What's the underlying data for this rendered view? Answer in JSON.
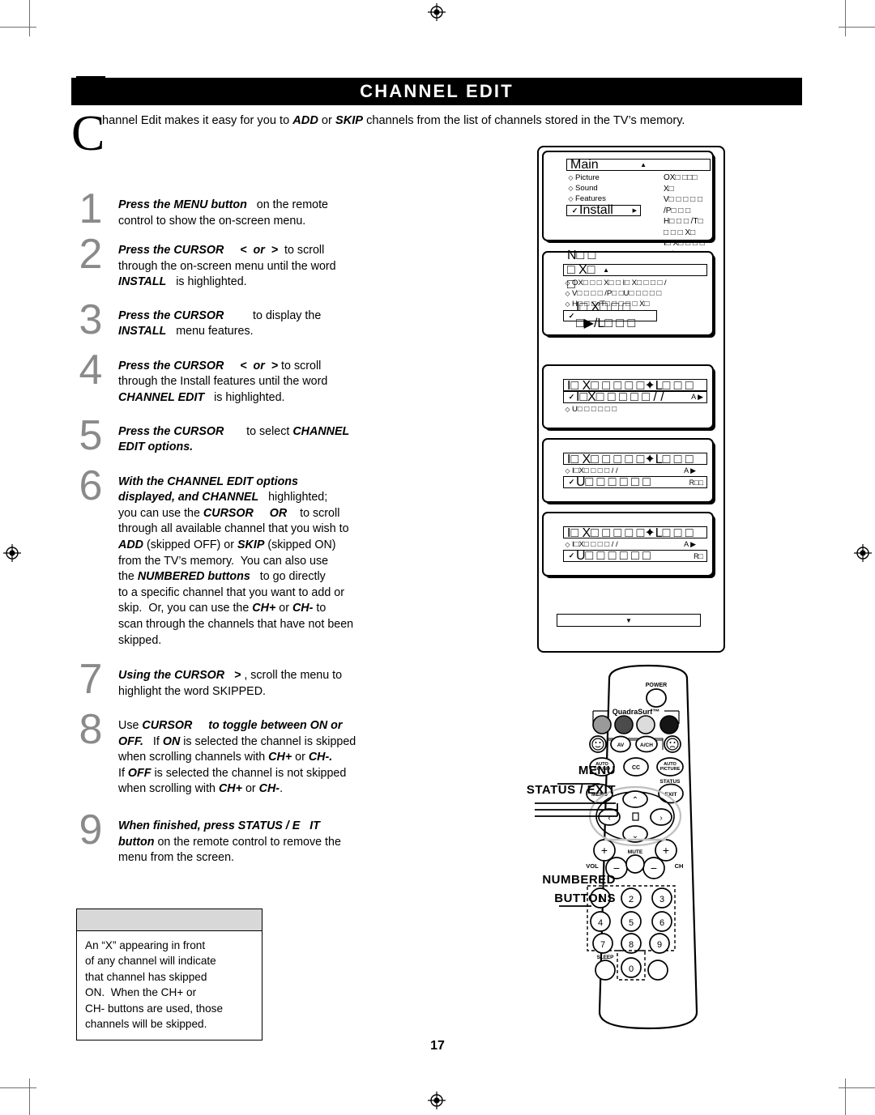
{
  "page": {
    "number": "17",
    "title": "CHANNEL EDIT"
  },
  "intro": {
    "dropcap": "C",
    "text_1": "hannel Edit makes it easy for you to ",
    "bold_1": "ADD",
    "text_2": " or ",
    "bold_2": "SKIP",
    "text_3": " channels from the list of channels stored in the TV’s memory."
  },
  "steps": [
    {
      "number": "1",
      "lines": [
        {
          "bold": "Press the MENU button",
          "rest": "  on the remote"
        },
        {
          "bold": "",
          "rest": "control to show the on-screen menu."
        }
      ]
    },
    {
      "number": "2",
      "lines": [
        {
          "bold": "Press the CURSOR",
          "rest": "   <   or  >   to scroll"
        },
        {
          "bold": "",
          "rest": "through the on-screen menu until the word"
        },
        {
          "bold": "INSTALL",
          "rest": "  is highlighted."
        }
      ]
    },
    {
      "number": "3",
      "lines": [
        {
          "bold": "Press the CURSOR",
          "rest": "          to display the"
        },
        {
          "bold": "INSTALL",
          "rest": "  menu features."
        }
      ]
    },
    {
      "number": "4",
      "lines": [
        {
          "bold": "Press the CURSOR",
          "rest": "   <   or  >  to scroll"
        },
        {
          "bold": "",
          "rest": "through the Install features until the word"
        },
        {
          "bold": "CHANNEL EDIT",
          "rest": "   is highlighted."
        }
      ]
    },
    {
      "number": "5",
      "lines": [
        {
          "bold": "Press the CURSOR",
          "rest": "        to select "
        },
        {
          "bold": "CHANNEL EDIT options.",
          "rest": ""
        }
      ]
    },
    {
      "number": "6",
      "lines": [
        {
          "bold": "With the CHANNEL EDIT options",
          "rest": ""
        },
        {
          "bold": "displayed, and CHANNEL",
          "rest": "    highlighted;"
        },
        {
          "bold": "",
          "rest": "you can use the "
        },
        {
          "bold": "CURSOR       OR",
          "rest": "    to scroll"
        },
        {
          "bold": "",
          "rest": "through all available channel that you wish to"
        },
        {
          "bold": "ADD",
          "rest": " (skipped OFF) or "
        },
        {
          "bold": "SKIP",
          "rest": " (skipped ON)"
        },
        {
          "bold": "",
          "rest": "from the TV’s memory.  You can also use"
        },
        {
          "bold": "the NUMBERED buttons",
          "rest": "   to go directly"
        },
        {
          "bold": "",
          "rest": "to a specific channel that you want to add or"
        },
        {
          "bold": "",
          "rest": "skip.  Or, you can use the "
        },
        {
          "bold": "CH+",
          "rest": " or "
        },
        {
          "bold": "CH-",
          "rest": " to"
        },
        {
          "bold": "",
          "rest": "scan through the channels that have not been"
        },
        {
          "bold": "",
          "rest": "skipped."
        }
      ]
    },
    {
      "number": "7",
      "lines": [
        {
          "bold": "Using the CURSOR",
          "rest": "   > , scroll the menu to"
        },
        {
          "bold": "",
          "rest": "highlight the word SKIPPED."
        }
      ]
    },
    {
      "number": "8",
      "lines": [
        {
          "bold": "",
          "rest": "Use "
        },
        {
          "bold": "CURSOR     to toggle between ON or",
          "rest": ""
        },
        {
          "bold": "OFF.",
          "rest": "   If "
        },
        {
          "bold": "ON",
          "rest": " is selected the channel is skipped"
        },
        {
          "bold": "",
          "rest": "when scrolling channels with "
        },
        {
          "bold": "CH+",
          "rest": " or "
        },
        {
          "bold": "CH-.",
          "rest": ""
        },
        {
          "bold": "",
          "rest": "If "
        },
        {
          "bold": "OFF",
          "rest": " is selected the channel is not skipped"
        },
        {
          "bold": "",
          "rest": "when scrolling with "
        },
        {
          "bold": "CH+",
          "rest": " or "
        },
        {
          "bold": "CH-",
          "rest": "."
        }
      ]
    },
    {
      "number": "9",
      "lines": [
        {
          "bold": "When finished, press STATUS / E    IT",
          "rest": ""
        },
        {
          "bold": "button",
          "rest": " on the remote control to  remove the"
        },
        {
          "bold": "",
          "rest": "menu from the screen."
        }
      ]
    }
  ],
  "step_text": {
    "s1": "Press the MENU button   on the remote control to show the on-screen menu.",
    "s2": "Press the CURSOR    <  or >   to scroll through the on-screen menu until the word INSTALL   is highlighted.",
    "s3": "Press the CURSOR          to display the INSTALL   menu features.",
    "s4": "Press the CURSOR    <  or >  to scroll through the Install features until the word CHANNEL EDIT   is highlighted.",
    "s5": "Press the CURSOR       to select CHANNEL EDIT options.",
    "s6": "With the CHANNEL EDIT options displayed, and CHANNEL   highlighted; you can use the CURSOR    OR    to scroll through all available channel that you wish to ADD  (skipped OFF) or SKIP  (skipped ON) from the TV's memory.  You can also use the NUMBERED buttons   to go directly to a specific channel that you want to add or skip.  Or, you can use the CH+ or CH- to scan through the channels that have not been skipped.",
    "s7": "Using the CURSOR   > , scroll the menu to highlight the word SKIPPED.",
    "s8": "Use CURSOR    to toggle between ON or OFF.   If ON is selected the channel is skipped when scrolling channels with CH+ or CH-.  If OFF  is selected the channel is not skipped when scrolling with CH+ or CH- .",
    "s9": "When finished, press STATUS / E   IT button  on the remote control to  remove the menu from the screen."
  },
  "note": {
    "header": "",
    "text": "An “X” appearing in front of any channel will indicate that channel has skipped ON.  When the CH+ or CH- buttons are used, those channels will be skipped."
  },
  "osd": {
    "panel1": {
      "header": "Main",
      "header_arrow": "▲",
      "items": [
        {
          "marker": "◇",
          "label": "Picture"
        },
        {
          "marker": "◇",
          "label": "Sound"
        },
        {
          "marker": "◇",
          "label": "Features"
        },
        {
          "marker": "✓",
          "label": "Install",
          "arrow": "▶",
          "selected": true
        }
      ],
      "right_col": [
        "OX□ □□□ X□",
        "V□ □ □ □ □ /P□ □ □",
        "H□ □ □ /T□ □ □ □ X□",
        "I□ X□ □ □ □ □ /L□ □ □"
      ]
    },
    "panel2": {
      "header": "N□ □ □ X□ □",
      "header_arrow": "▲",
      "rows": [
        {
          "marker": "◇",
          "text": "OX□ □ □ X□ □  I□ X□ □ □ □ /"
        },
        {
          "marker": "◇",
          "text": "V□ □ □ □ /P□ □U□ □ □ □ □"
        },
        {
          "marker": "◇",
          "text": "H□ □ □ /T□ □ □ □ □ X□"
        },
        {
          "marker": "✓",
          "text": "I□ X□ □ □ □▶/L□ □ □",
          "selected": true
        }
      ]
    },
    "panel3": {
      "header": "I□ X□ □ □ □ □✦L□ □ □",
      "rows": [
        {
          "marker": "✓",
          "text": "I□X□ □ □ □ □ / /",
          "right": "A  ▶",
          "selected": true
        },
        {
          "marker": "◇",
          "text": "U□ □ □ □ □ □",
          "right": ""
        }
      ]
    },
    "panel4": {
      "header": "I□ X□ □ □ □ □✦L□ □ □",
      "rows": [
        {
          "marker": "◇",
          "text": "I□X□ □ □ □ / /",
          "right": "A  ▶"
        },
        {
          "marker": "✓",
          "text": "U□ □ □ □ □ □",
          "right": "R□□",
          "selected": true
        }
      ]
    },
    "panel5": {
      "header": "I□ X□ □ □ □ □✦L□ □ □",
      "rows": [
        {
          "marker": "◇",
          "text": "I□X□ □ □ □ / /",
          "right": "A  ▶"
        },
        {
          "marker": "✓",
          "text": "U□ □ □ □ □ □",
          "right": "R□",
          "selected": true
        }
      ]
    },
    "scroll_down": "▼"
  },
  "remote": {
    "power_label": "POWER",
    "quadrasurf_label": "QuadraSurf™",
    "buttons": {
      "av": "AV",
      "ach": "A/CH",
      "auto_sound": "AUTO SOUND",
      "cc": "CC",
      "auto_picture": "AUTO PICTURE",
      "menu": "MENU",
      "status": "STATUS",
      "exit": "EXIT",
      "mute": "MUTE",
      "vol": "VOL",
      "ch": "CH",
      "sleep": "SLEEP"
    },
    "keypad": [
      "1",
      "2",
      "3",
      "4",
      "5",
      "6",
      "7",
      "8",
      "9",
      "0"
    ],
    "callouts": {
      "menu": "MENU",
      "status_exit": "STATUS / EXIT",
      "numbered_line1": "NUMBERED",
      "numbered_line2": "BUTTONS"
    }
  },
  "colors": {
    "title_bg": "#000000",
    "step_number": "#8a8a8a",
    "note_header": "#d8d8d8",
    "crop_mark": "#6f6f6f"
  }
}
